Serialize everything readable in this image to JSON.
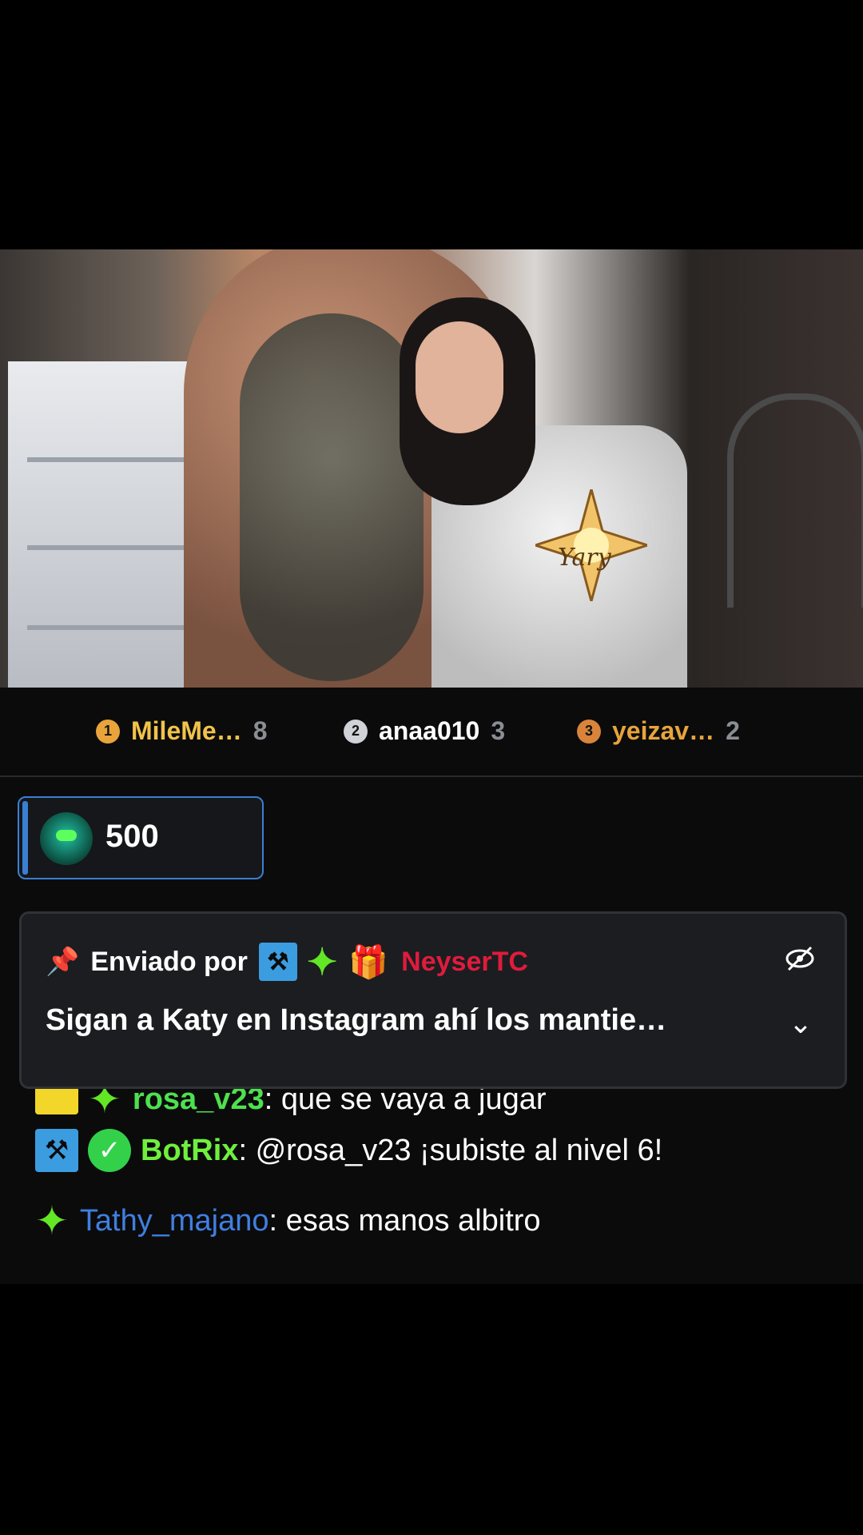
{
  "video": {
    "watermark": "Yary"
  },
  "leaderboard": [
    {
      "rank": "1",
      "name": "MileMe…",
      "count": "8",
      "rank_color": "#e8a43a",
      "name_color": "#f2c34a"
    },
    {
      "rank": "2",
      "name": "anaa010",
      "count": "3",
      "rank_color": "#cfd2d6",
      "name_color": "#ffffff"
    },
    {
      "rank": "3",
      "name": "yeizav…",
      "count": "2",
      "rank_color": "#d8843a",
      "name_color": "#e8a43a"
    }
  ],
  "gift": {
    "amount": "500"
  },
  "pinned": {
    "sent_by_label": "Enviado por",
    "author": "NeyserTC",
    "author_color": "#e01b3c",
    "text": "Sigan a Katy en Instagram ahí los mantie…"
  },
  "messages": [
    {
      "user": "rosa_v23",
      "text": ": que se vaya a jugar",
      "user_color": "#4ee04e"
    },
    {
      "user": "BotRix",
      "text": ": @rosa_v23 ¡subiste al nivel 6!",
      "user_color": "#6ff03c"
    },
    {
      "user": "Tathy_majano",
      "text": ": esas manos albitro",
      "user_color": "#3f7fe0"
    }
  ],
  "colors": {
    "accent": "#3a7fd1",
    "background": "#0b0b0c"
  }
}
